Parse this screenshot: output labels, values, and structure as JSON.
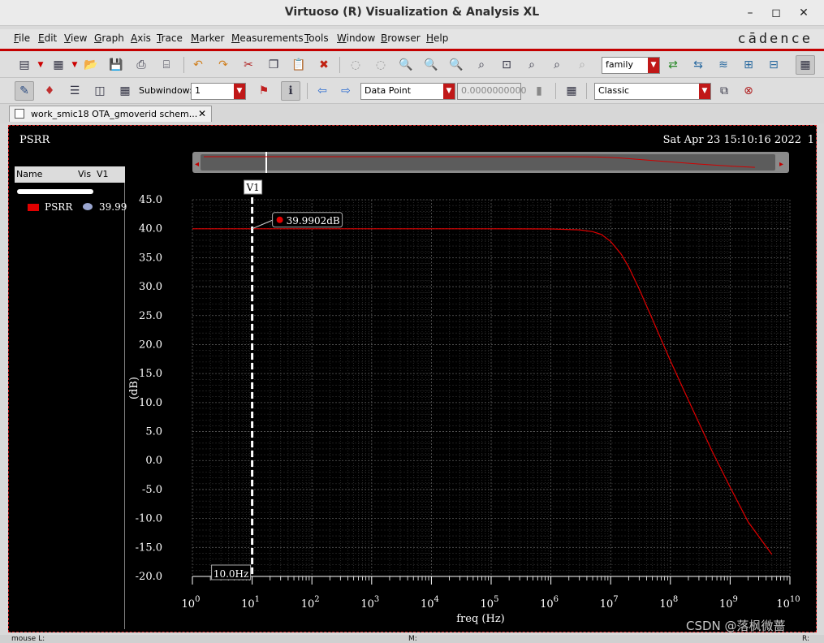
{
  "window": {
    "title": "Virtuoso (R) Visualization & Analysis XL",
    "minimize_icon": "minimize-icon",
    "maximize_icon": "maximize-icon",
    "close_icon": "close-icon"
  },
  "menu": {
    "items": [
      {
        "first": "F",
        "rest": "ile"
      },
      {
        "first": "E",
        "rest": "dit"
      },
      {
        "first": "V",
        "rest": "iew"
      },
      {
        "first": "G",
        "rest": "raph"
      },
      {
        "first": "A",
        "rest": "xis"
      },
      {
        "first": "T",
        "rest": "race"
      },
      {
        "first": "M",
        "rest": "arker"
      },
      {
        "first": "M",
        "rest": "easurements"
      },
      {
        "first": "T",
        "rest": "ools"
      },
      {
        "first": "W",
        "rest": "indow"
      },
      {
        "first": "B",
        "rest": "rowser"
      },
      {
        "first": "H",
        "rest": "elp"
      }
    ],
    "brand": "cādence"
  },
  "toolbar1": {
    "family_value": "family"
  },
  "toolbar2": {
    "subwindow_label": "Subwindow:",
    "subwindow_value": "1",
    "marker_mode": "Data Point",
    "marker_value": "0.0000000000",
    "style_value": "Classic"
  },
  "tab": {
    "label": "work_smic18 OTA_gmoverid schem...",
    "close": "✕"
  },
  "plot": {
    "title": "PSRR",
    "date": "Sat Apr 23 15:10:16 2022",
    "page": "1",
    "legend_headers": {
      "name": "Name",
      "vis": "Vis",
      "v1": "V1"
    },
    "legend_trace": {
      "name": "PSRR",
      "value": "39.99",
      "color": "#e00000"
    },
    "marker": {
      "name": "V1",
      "readout": "39.9902dB",
      "x_readout": "10.0Hz"
    }
  },
  "chart_data": {
    "type": "line",
    "xlabel": "freq (Hz)",
    "ylabel": "(dB)",
    "xscale": "log",
    "xlim": [
      1,
      10000000000
    ],
    "ylim": [
      -20,
      45
    ],
    "grid": true,
    "x_ticks": [
      {
        "base": "10",
        "exp": "0",
        "v": 1
      },
      {
        "base": "10",
        "exp": "1",
        "v": 10
      },
      {
        "base": "10",
        "exp": "2",
        "v": 100
      },
      {
        "base": "10",
        "exp": "3",
        "v": 1000
      },
      {
        "base": "10",
        "exp": "4",
        "v": 10000
      },
      {
        "base": "10",
        "exp": "5",
        "v": 100000
      },
      {
        "base": "10",
        "exp": "6",
        "v": 1000000
      },
      {
        "base": "10",
        "exp": "7",
        "v": 10000000
      },
      {
        "base": "10",
        "exp": "8",
        "v": 100000000
      },
      {
        "base": "10",
        "exp": "9",
        "v": 1000000000
      },
      {
        "base": "10",
        "exp": "10",
        "v": 10000000000
      }
    ],
    "y_ticks": [
      "45.0",
      "40.0",
      "35.0",
      "30.0",
      "25.0",
      "20.0",
      "15.0",
      "10.0",
      "5.0",
      "0.0",
      "-5.0",
      "-10.0",
      "-15.0",
      "-20.0"
    ],
    "series": [
      {
        "name": "PSRR",
        "color": "#e00000",
        "x": [
          1,
          10,
          100,
          1000,
          10000,
          100000,
          1000000,
          3000000,
          5000000,
          7000000,
          10000000,
          15000000,
          20000000,
          30000000,
          50000000,
          100000000,
          200000000,
          500000000,
          1000000000,
          2000000000,
          5000000000
        ],
        "y": [
          39.99,
          39.99,
          39.99,
          39.99,
          39.99,
          39.99,
          39.95,
          39.8,
          39.5,
          39.0,
          37.8,
          35.6,
          33.4,
          29.6,
          24.4,
          17.2,
          10.4,
          1.6,
          -4.6,
          -10.6,
          -16.2
        ]
      }
    ],
    "marker_x": 10
  },
  "status": {
    "left": "mouse L:",
    "mid": "M:",
    "right": "R:"
  },
  "watermark": "CSDN @落枫微蔷"
}
